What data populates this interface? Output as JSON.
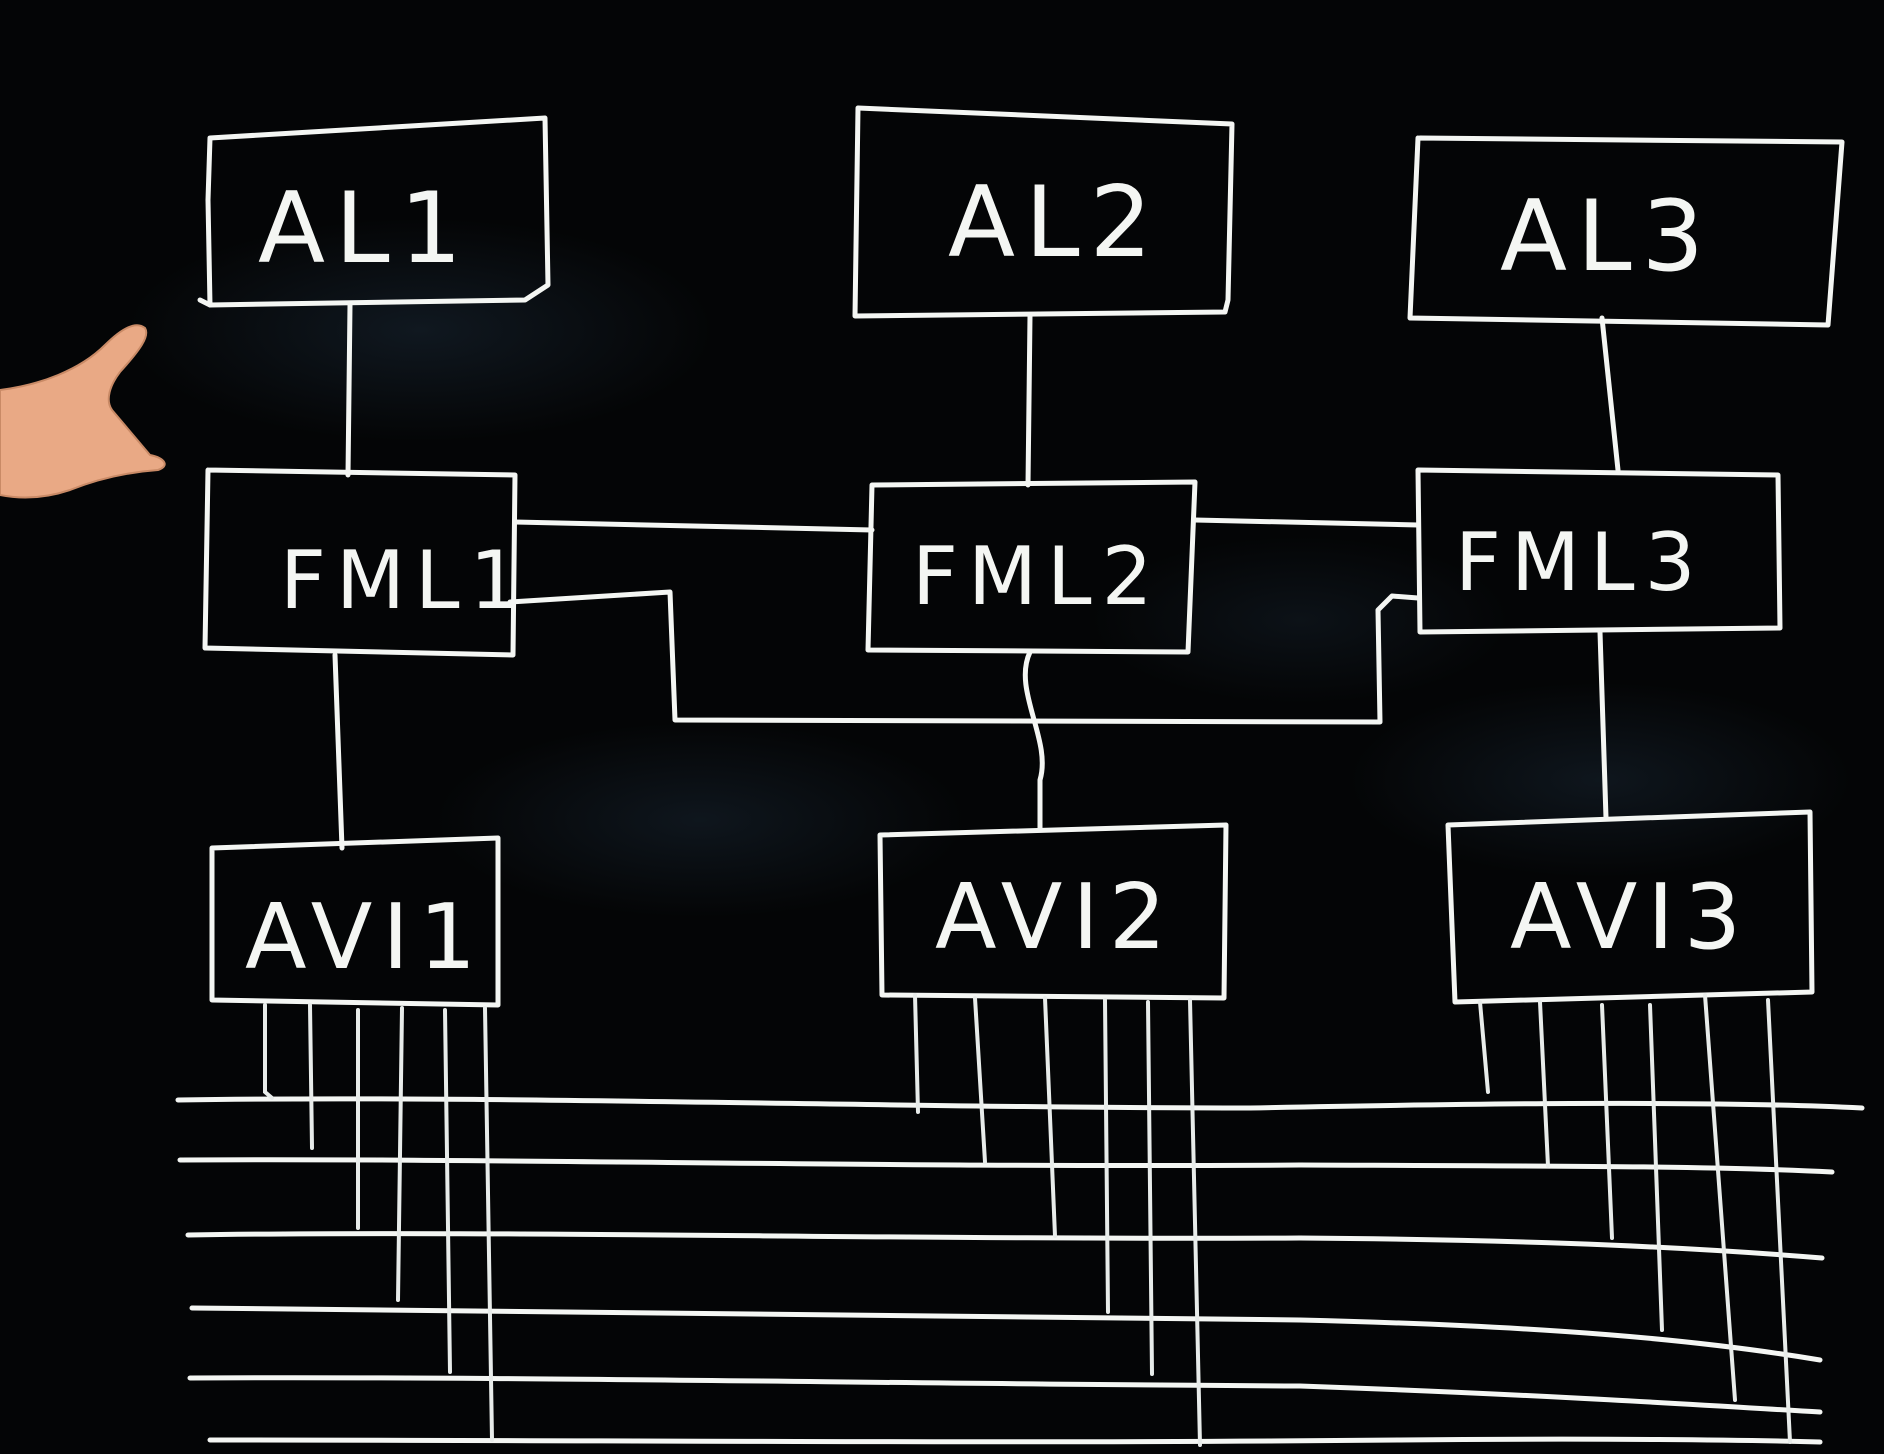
{
  "diagram": {
    "nodes": [
      {
        "id": "AL1",
        "label": "AL1",
        "tier": "top"
      },
      {
        "id": "AL2",
        "label": "AL2",
        "tier": "top"
      },
      {
        "id": "AL3",
        "label": "AL3",
        "tier": "top"
      },
      {
        "id": "FML1",
        "label": "FML1",
        "tier": "middle"
      },
      {
        "id": "FML2",
        "label": "FML2",
        "tier": "middle"
      },
      {
        "id": "FML3",
        "label": "FML3",
        "tier": "middle"
      },
      {
        "id": "AVI1",
        "label": "AVI1",
        "tier": "bottom"
      },
      {
        "id": "AVI2",
        "label": "AVI2",
        "tier": "bottom"
      },
      {
        "id": "AVI3",
        "label": "AVI3",
        "tier": "bottom"
      }
    ],
    "edges": [
      {
        "from": "AL1",
        "to": "FML1"
      },
      {
        "from": "AL2",
        "to": "FML2"
      },
      {
        "from": "AL3",
        "to": "FML3"
      },
      {
        "from": "FML1",
        "to": "FML2"
      },
      {
        "from": "FML2",
        "to": "FML3"
      },
      {
        "from": "FML1",
        "to": "FML3"
      },
      {
        "from": "FML1",
        "to": "AVI1"
      },
      {
        "from": "FML2",
        "to": "AVI2"
      },
      {
        "from": "FML3",
        "to": "AVI3"
      }
    ],
    "bus_line_count": 6,
    "drops_per_avi": 6,
    "style": "white chalk on blackboard"
  }
}
